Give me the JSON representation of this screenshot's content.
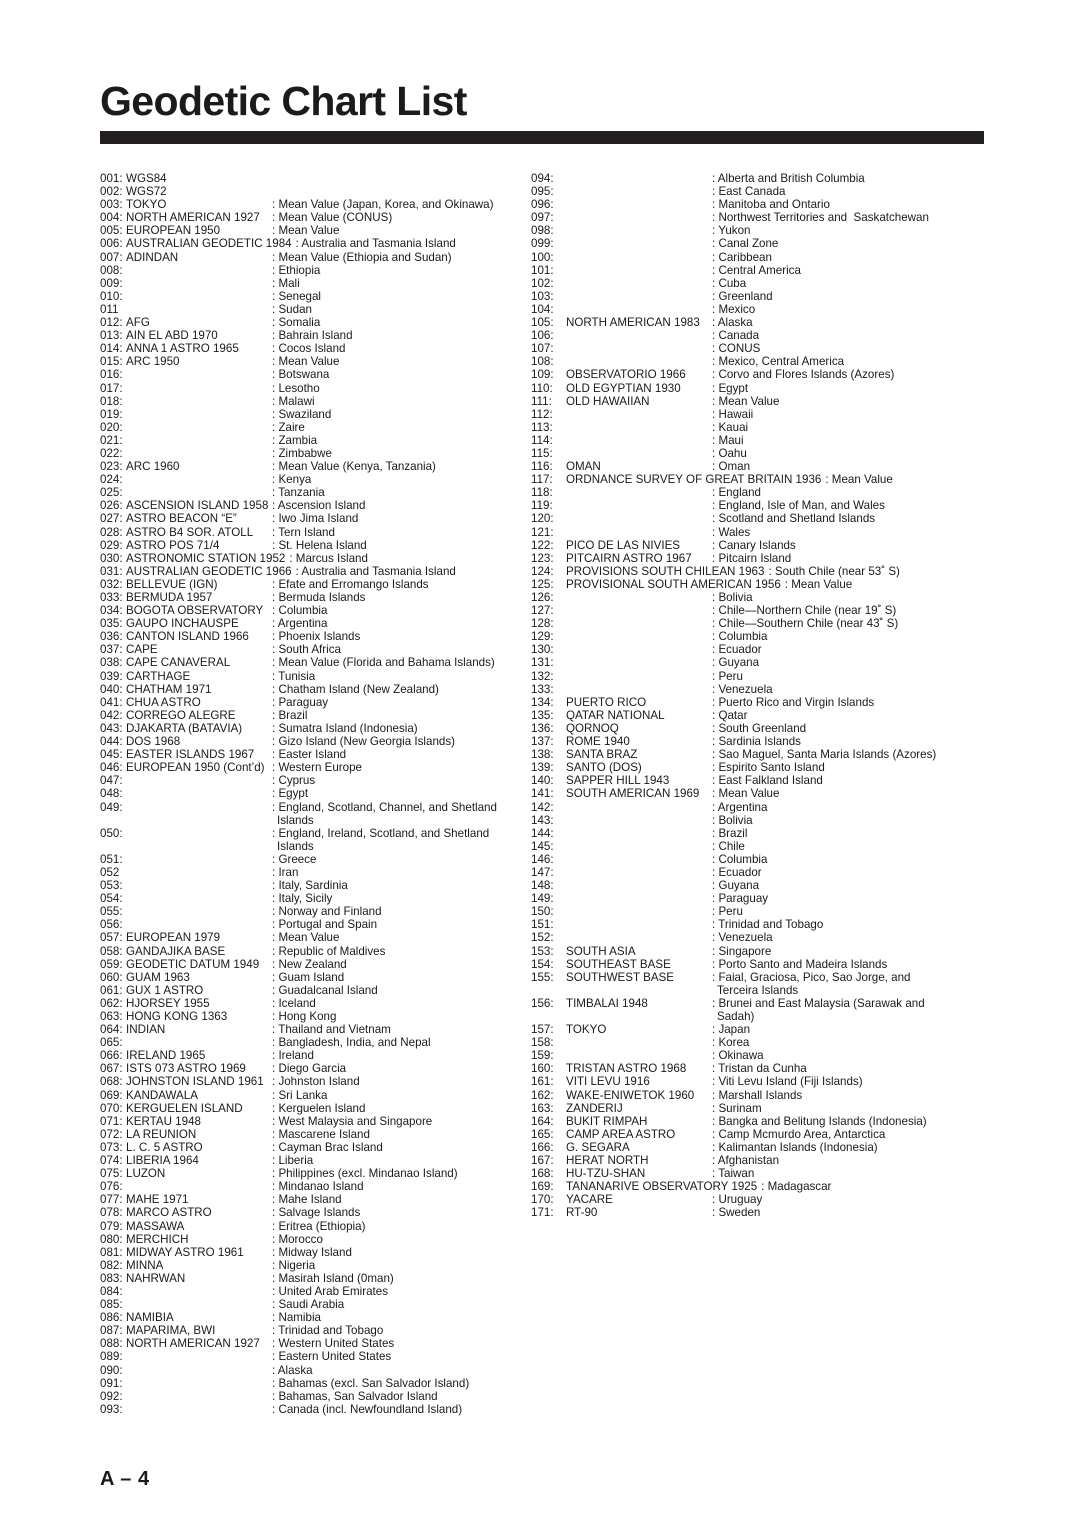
{
  "document": {
    "title": "Geodetic Chart List",
    "page_label": "A – 4"
  },
  "left_column": [
    {
      "num": "001:",
      "name": "WGS84",
      "desc": ""
    },
    {
      "num": "002:",
      "name": "WGS72",
      "desc": ""
    },
    {
      "num": "003:",
      "name": "TOKYO",
      "desc": ": Mean Value (Japan, Korea, and Okinawa)"
    },
    {
      "num": "004:",
      "name": "NORTH AMERICAN 1927",
      "desc": ": Mean Value (CONUS)"
    },
    {
      "num": "005:",
      "name": "EUROPEAN 1950",
      "desc": ": Mean Value"
    },
    {
      "num": "006:",
      "name": "AUSTRALIAN GEODETIC 1984",
      "desc": ": Australia and Tasmania Island",
      "wide": true
    },
    {
      "num": "007:",
      "name": "ADINDAN",
      "desc": ": Mean Value (Ethiopia and Sudan)"
    },
    {
      "num": "008:",
      "name": "",
      "desc": ": Ethiopia"
    },
    {
      "num": "009:",
      "name": "",
      "desc": ": Mali"
    },
    {
      "num": "010:",
      "name": "",
      "desc": ": Senegal"
    },
    {
      "num": "011",
      "name": "",
      "desc": ": Sudan"
    },
    {
      "num": "012:",
      "name": "AFG",
      "desc": ": Somalia"
    },
    {
      "num": "013:",
      "name": "AIN EL ABD 1970",
      "desc": ": Bahrain Island"
    },
    {
      "num": "014:",
      "name": "ANNA 1 ASTRO 1965",
      "desc": ": Cocos Island"
    },
    {
      "num": "015:",
      "name": "ARC 1950",
      "desc": ": Mean Value"
    },
    {
      "num": "016:",
      "name": "",
      "desc": ": Botswana"
    },
    {
      "num": "017:",
      "name": "",
      "desc": ": Lesotho"
    },
    {
      "num": "018:",
      "name": "",
      "desc": ": Malawi"
    },
    {
      "num": "019:",
      "name": "",
      "desc": ": Swaziland"
    },
    {
      "num": "020:",
      "name": "",
      "desc": ": Zaire"
    },
    {
      "num": "021:",
      "name": "",
      "desc": ": Zambia"
    },
    {
      "num": "022:",
      "name": "",
      "desc": ": Zimbabwe"
    },
    {
      "num": "023:",
      "name": "ARC 1960",
      "desc": ": Mean Value (Kenya, Tanzania)"
    },
    {
      "num": "024:",
      "name": "",
      "desc": ": Kenya"
    },
    {
      "num": "025:",
      "name": "",
      "desc": ": Tanzania"
    },
    {
      "num": "026:",
      "name": "ASCENSION ISLAND 1958",
      "desc": ": Ascension Island"
    },
    {
      "num": "027:",
      "name": "ASTRO BEACON “E”",
      "desc": ": Iwo Jima Island"
    },
    {
      "num": "028:",
      "name": "ASTRO B4 SOR. ATOLL",
      "desc": ": Tern Island"
    },
    {
      "num": "029:",
      "name": "ASTRO POS 71/4",
      "desc": ": St. Helena Island"
    },
    {
      "num": "030:",
      "name": "ASTRONOMIC STATION 1952",
      "desc": ": Marcus Island",
      "wide": true
    },
    {
      "num": "031:",
      "name": "AUSTRALIAN GEODETIC 1966",
      "desc": ": Australia and Tasmania Island",
      "wide": true
    },
    {
      "num": "032:",
      "name": "BELLEVUE (IGN)",
      "desc": ": Efate and Erromango Islands"
    },
    {
      "num": "033:",
      "name": "BERMUDA 1957",
      "desc": ": Bermuda Islands"
    },
    {
      "num": "034:",
      "name": "BOGOTA OBSERVATORY",
      "desc": ": Columbia"
    },
    {
      "num": "035:",
      "name": "GAUPO INCHAUSPE",
      "desc": ": Argentina"
    },
    {
      "num": "036:",
      "name": "CANTON ISLAND 1966",
      "desc": ": Phoenix Islands"
    },
    {
      "num": "037:",
      "name": "CAPE",
      "desc": ": South Africa"
    },
    {
      "num": "038:",
      "name": "CAPE CANAVERAL",
      "desc": ": Mean Value (Florida and Bahama Islands)"
    },
    {
      "num": "039:",
      "name": "CARTHAGE",
      "desc": ": Tunisia"
    },
    {
      "num": "040:",
      "name": "CHATHAM 1971",
      "desc": ": Chatham Island (New Zealand)"
    },
    {
      "num": "041:",
      "name": "CHUA ASTRO",
      "desc": ": Paraguay"
    },
    {
      "num": "042:",
      "name": "CORREGO ALEGRE",
      "desc": ": Brazil"
    },
    {
      "num": "043:",
      "name": "DJAKARTA (BATAVIA)",
      "desc": ": Sumatra Island (Indonesia)"
    },
    {
      "num": "044:",
      "name": "DOS 1968",
      "desc": ": Gizo Island (New Georgia Islands)"
    },
    {
      "num": "045:",
      "name": "EASTER ISLANDS 1967",
      "desc": ": Easter Island"
    },
    {
      "num": "046:",
      "name": "EUROPEAN 1950 (Cont’d)",
      "desc": ": Western Europe"
    },
    {
      "num": "047:",
      "name": "",
      "desc": ": Cyprus"
    },
    {
      "num": "048:",
      "name": "",
      "desc": ": Egypt"
    },
    {
      "num": "049:",
      "name": "",
      "desc": ": England, Scotland, Channel, and Shetland",
      "cont": "Islands"
    },
    {
      "num": "050:",
      "name": "",
      "desc": ": England, Ireland, Scotland, and Shetland",
      "cont": "Islands"
    },
    {
      "num": "051:",
      "name": "",
      "desc": ": Greece"
    },
    {
      "num": "052",
      "name": "",
      "desc": ": Iran"
    },
    {
      "num": "053:",
      "name": "",
      "desc": ": Italy, Sardinia"
    },
    {
      "num": "054:",
      "name": "",
      "desc": ": Italy, Sicily"
    },
    {
      "num": "055:",
      "name": "",
      "desc": ": Norway and Finland"
    },
    {
      "num": "056:",
      "name": "",
      "desc": ": Portugal and Spain"
    },
    {
      "num": "057:",
      "name": "EUROPEAN 1979",
      "desc": ": Mean Value"
    },
    {
      "num": "058:",
      "name": "GANDAJIKA BASE",
      "desc": ": Republic of Maldives"
    },
    {
      "num": "059:",
      "name": "GEODETIC DATUM 1949",
      "desc": ": New Zealand"
    },
    {
      "num": "060:",
      "name": "GUAM 1963",
      "desc": ": Guam Island"
    },
    {
      "num": "061:",
      "name": "GUX 1 ASTRO",
      "desc": ": Guadalcanal Island"
    },
    {
      "num": "062:",
      "name": "HJORSEY 1955",
      "desc": ": Iceland"
    },
    {
      "num": "063:",
      "name": "HONG KONG 1363",
      "desc": ": Hong Kong"
    },
    {
      "num": "064:",
      "name": "INDIAN",
      "desc": ": Thailand and Vietnam"
    },
    {
      "num": "065:",
      "name": "",
      "desc": ": Bangladesh, India, and Nepal"
    },
    {
      "num": "066:",
      "name": "IRELAND 1965",
      "desc": ": Ireland"
    },
    {
      "num": "067:",
      "name": "ISTS 073 ASTRO 1969",
      "desc": ": Diego Garcia"
    },
    {
      "num": "068:",
      "name": "JOHNSTON ISLAND 1961",
      "desc": ": Johnston Island"
    },
    {
      "num": "069:",
      "name": "KANDAWALA",
      "desc": ": Sri Lanka"
    },
    {
      "num": "070:",
      "name": "KERGUELEN ISLAND",
      "desc": ": Kerguelen Island"
    },
    {
      "num": "071:",
      "name": "KERTAU 1948",
      "desc": ": West Malaysia and Singapore"
    },
    {
      "num": "072:",
      "name": "LA REUNION",
      "desc": ": Mascarene Island"
    },
    {
      "num": "073:",
      "name": "L. C. 5 ASTRO",
      "desc": ": Cayman Brac Island"
    },
    {
      "num": "074:",
      "name": "LIBERIA 1964",
      "desc": ": Liberia"
    },
    {
      "num": "075:",
      "name": "LUZON",
      "desc": ": Philippines (excl. Mindanao Island)"
    },
    {
      "num": "076:",
      "name": "",
      "desc": ": Mindanao Island"
    },
    {
      "num": "077:",
      "name": "MAHE 1971",
      "desc": ": Mahe Island"
    },
    {
      "num": "078:",
      "name": "MARCO ASTRO",
      "desc": ": Salvage Islands"
    },
    {
      "num": "079:",
      "name": "MASSAWA",
      "desc": ": Eritrea (Ethiopia)"
    },
    {
      "num": "080:",
      "name": "MERCHICH",
      "desc": ": Morocco"
    },
    {
      "num": "081:",
      "name": "MIDWAY ASTRO 1961",
      "desc": ": Midway Island"
    },
    {
      "num": "082:",
      "name": "MINNA",
      "desc": ": Nigeria"
    },
    {
      "num": "083:",
      "name": "NAHRWAN",
      "desc": ": Masirah Island (0man)"
    },
    {
      "num": "084:",
      "name": "",
      "desc": ": United Arab Emirates"
    },
    {
      "num": "085:",
      "name": "",
      "desc": ": Saudi Arabia"
    },
    {
      "num": "086:",
      "name": "NAMIBIA",
      "desc": ": Namibia"
    },
    {
      "num": "087:",
      "name": "MAPARIMA, BWI",
      "desc": ": Trinidad and Tobago"
    },
    {
      "num": "088:",
      "name": "NORTH AMERICAN 1927",
      "desc": ": Western United States"
    },
    {
      "num": "089:",
      "name": "",
      "desc": ": Eastern United States"
    },
    {
      "num": "090:",
      "name": "",
      "desc": ": Alaska"
    },
    {
      "num": "091:",
      "name": "",
      "desc": ": Bahamas (excl. San Salvador Island)"
    },
    {
      "num": "092:",
      "name": "",
      "desc": ": Bahamas, San Salvador Island"
    },
    {
      "num": "093:",
      "name": "",
      "desc": ": Canada (incl. Newfoundland Island)"
    }
  ],
  "right_column": [
    {
      "num": "094:",
      "name": "",
      "desc": ": Alberta and British Columbia"
    },
    {
      "num": "095:",
      "name": "",
      "desc": ": East Canada"
    },
    {
      "num": "096:",
      "name": "",
      "desc": ": Manitoba and Ontario"
    },
    {
      "num": "097:",
      "name": "",
      "desc": ": Northwest Territories and  Saskatchewan"
    },
    {
      "num": "098:",
      "name": "",
      "desc": ": Yukon"
    },
    {
      "num": "099:",
      "name": "",
      "desc": ": Canal Zone"
    },
    {
      "num": "100:",
      "name": "",
      "desc": ": Caribbean"
    },
    {
      "num": "101:",
      "name": "",
      "desc": ": Central America"
    },
    {
      "num": "102:",
      "name": "",
      "desc": ": Cuba"
    },
    {
      "num": "103:",
      "name": "",
      "desc": ": Greenland"
    },
    {
      "num": "104:",
      "name": "",
      "desc": ": Mexico"
    },
    {
      "num": "105:",
      "name": "NORTH AMERICAN 1983",
      "desc": ": Alaska"
    },
    {
      "num": "106:",
      "name": "",
      "desc": ": Canada"
    },
    {
      "num": "107:",
      "name": "",
      "desc": ": CONUS"
    },
    {
      "num": "108:",
      "name": "",
      "desc": ": Mexico, Central America"
    },
    {
      "num": "109:",
      "name": "OBSERVATORIO 1966",
      "desc": ": Corvo and Flores Islands (Azores)"
    },
    {
      "num": "110:",
      "name": "OLD EGYPTIAN 1930",
      "desc": ": Egypt"
    },
    {
      "num": "111:",
      "name": "OLD HAWAIIAN",
      "desc": ": Mean Value"
    },
    {
      "num": "112:",
      "name": "",
      "desc": ": Hawaii"
    },
    {
      "num": "113:",
      "name": "",
      "desc": ": Kauai"
    },
    {
      "num": "114:",
      "name": "",
      "desc": ": Maui"
    },
    {
      "num": "115:",
      "name": "",
      "desc": ": Oahu"
    },
    {
      "num": "116:",
      "name": "OMAN",
      "desc": ": Oman"
    },
    {
      "num": "117:",
      "name": "ORDNANCE SURVEY OF GREAT BRITAIN 1936",
      "desc": ": Mean Value",
      "wide": true
    },
    {
      "num": "118:",
      "name": "",
      "desc": ": England"
    },
    {
      "num": "119:",
      "name": "",
      "desc": ": England, Isle of Man, and Wales"
    },
    {
      "num": "120:",
      "name": "",
      "desc": ": Scotland and Shetland Islands"
    },
    {
      "num": "121:",
      "name": "",
      "desc": ": Wales"
    },
    {
      "num": "122:",
      "name": "PICO DE LAS NIVIES",
      "desc": ": Canary Islands"
    },
    {
      "num": "123:",
      "name": "PITCAIRN ASTRO 1967",
      "desc": ": Pitcairn Island"
    },
    {
      "num": "124:",
      "name": "PROVISIONS SOUTH CHILEAN 1963",
      "desc": ": South Chile (near 53˚ S)",
      "wide": true
    },
    {
      "num": "125:",
      "name": "PROVISIONAL SOUTH AMERICAN 1956",
      "desc": ": Mean Value",
      "wide": true
    },
    {
      "num": "126:",
      "name": "",
      "desc": ": Bolivia"
    },
    {
      "num": "127:",
      "name": "",
      "desc": ": Chile—Northern Chile (near 19˚ S)"
    },
    {
      "num": "128:",
      "name": "",
      "desc": ": Chile—Southern Chile (near 43˚ S)"
    },
    {
      "num": "129:",
      "name": "",
      "desc": ": Columbia"
    },
    {
      "num": "130:",
      "name": "",
      "desc": ": Ecuador"
    },
    {
      "num": "131:",
      "name": "",
      "desc": ": Guyana"
    },
    {
      "num": "132:",
      "name": "",
      "desc": ": Peru"
    },
    {
      "num": "133:",
      "name": "",
      "desc": ": Venezuela"
    },
    {
      "num": "134:",
      "name": "PUERTO RICO",
      "desc": ": Puerto Rico and Virgin Islands"
    },
    {
      "num": "135:",
      "name": "QATAR NATIONAL",
      "desc": ": Qatar"
    },
    {
      "num": "136:",
      "name": "QORNOQ",
      "desc": ": South Greenland"
    },
    {
      "num": "137:",
      "name": "ROME 1940",
      "desc": ": Sardinia Islands"
    },
    {
      "num": "138:",
      "name": "SANTA BRAZ",
      "desc": ": Sao Maguel, Santa Maria Islands (Azores)"
    },
    {
      "num": "139:",
      "name": "SANTO (DOS)",
      "desc": ": Espirito Santo Island"
    },
    {
      "num": "140:",
      "name": "SAPPER HILL 1943",
      "desc": ": East Falkland Island"
    },
    {
      "num": "141:",
      "name": "SOUTH AMERICAN 1969",
      "desc": ": Mean Value"
    },
    {
      "num": "142:",
      "name": "",
      "desc": ": Argentina"
    },
    {
      "num": "143:",
      "name": "",
      "desc": ": Bolivia"
    },
    {
      "num": "144:",
      "name": "",
      "desc": ": Brazil"
    },
    {
      "num": "145:",
      "name": "",
      "desc": ": Chile"
    },
    {
      "num": "146:",
      "name": "",
      "desc": ": Columbia"
    },
    {
      "num": "147:",
      "name": "",
      "desc": ": Ecuador"
    },
    {
      "num": "148:",
      "name": "",
      "desc": ": Guyana"
    },
    {
      "num": "149:",
      "name": "",
      "desc": ": Paraguay"
    },
    {
      "num": "150:",
      "name": "",
      "desc": ": Peru"
    },
    {
      "num": "151:",
      "name": "",
      "desc": ": Trinidad and Tobago"
    },
    {
      "num": "152:",
      "name": "",
      "desc": ": Venezuela"
    },
    {
      "num": "153:",
      "name": "SOUTH ASIA",
      "desc": ": Singapore"
    },
    {
      "num": "154:",
      "name": "SOUTHEAST BASE",
      "desc": ": Porto Santo and Madeira Islands"
    },
    {
      "num": "155:",
      "name": "SOUTHWEST BASE",
      "desc": ": Faial, Graciosa, Pico, Sao Jorge, and",
      "cont": "Terceira Islands"
    },
    {
      "num": "156:",
      "name": "TIMBALAI 1948",
      "desc": ": Brunei and East Malaysia (Sarawak and",
      "cont": "Sadah)"
    },
    {
      "num": "157:",
      "name": "TOKYO",
      "desc": ": Japan"
    },
    {
      "num": "158:",
      "name": "",
      "desc": ": Korea"
    },
    {
      "num": "159:",
      "name": "",
      "desc": ": Okinawa"
    },
    {
      "num": "160:",
      "name": "TRISTAN ASTRO 1968",
      "desc": ": Tristan da Cunha"
    },
    {
      "num": "161:",
      "name": "VITI LEVU 1916",
      "desc": ": Viti Levu Island (Fiji Islands)"
    },
    {
      "num": "162:",
      "name": "WAKE-ENIWETOK 1960",
      "desc": ": Marshall Islands"
    },
    {
      "num": "163:",
      "name": "ZANDERIJ",
      "desc": ": Surinam"
    },
    {
      "num": "164:",
      "name": "BUKIT RIMPAH",
      "desc": ": Bangka and Belitung Islands (Indonesia)"
    },
    {
      "num": "165:",
      "name": "CAMP AREA ASTRO",
      "desc": ": Camp Mcmurdo Area, Antarctica"
    },
    {
      "num": "166:",
      "name": "G. SEGARA",
      "desc": ": Kalimantan Islands (Indonesia)"
    },
    {
      "num": "167:",
      "name": "HERAT NORTH",
      "desc": ": Afghanistan"
    },
    {
      "num": "168:",
      "name": "HU-TZU-SHAN",
      "desc": ": Taiwan"
    },
    {
      "num": "169:",
      "name": "TANANARIVE OBSERVATORY 1925",
      "desc": ": Madagascar",
      "wide": true
    },
    {
      "num": "170:",
      "name": "YACARE",
      "desc": ": Uruguay"
    },
    {
      "num": "171:",
      "name": "RT-90",
      "desc": ": Sweden"
    }
  ]
}
